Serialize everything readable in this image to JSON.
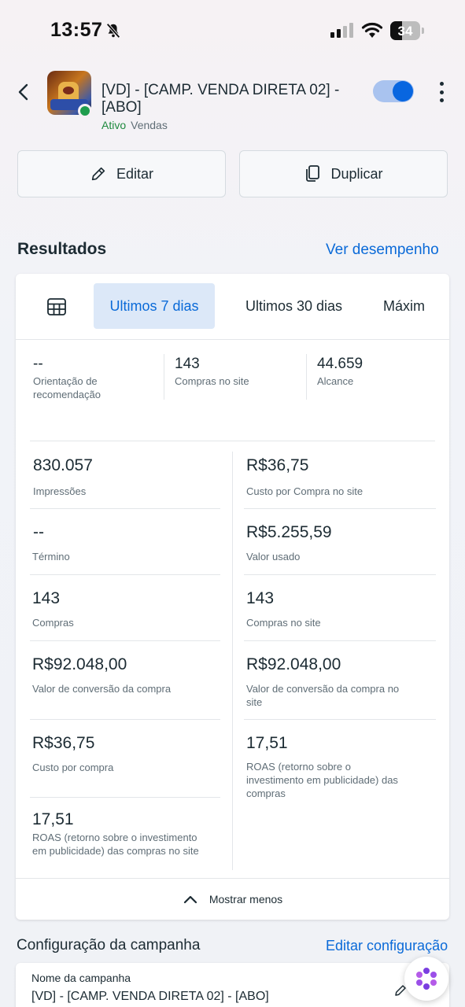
{
  "status_bar": {
    "time": "13:57",
    "battery": "34"
  },
  "header": {
    "campaign_title": "[VD] - [CAMP. VENDA DIRETA 02] - [ABO]",
    "status": "Ativo",
    "objective": "Vendas"
  },
  "actions": {
    "edit_label": "Editar",
    "duplicate_label": "Duplicar"
  },
  "results": {
    "title": "Resultados",
    "link": "Ver desempenho",
    "tabs": [
      "Ultimos 7 dias",
      "Ultimos 30 dias",
      "Máxim"
    ],
    "top_metrics": [
      {
        "value": "--",
        "label": "Orientação de recomendação"
      },
      {
        "value": "143",
        "label": "Compras no site"
      },
      {
        "value": "44.659",
        "label": "Alcance"
      }
    ],
    "left_metrics": [
      {
        "value": "830.057",
        "label": "Impressões"
      },
      {
        "value": "--",
        "label": "Término"
      },
      {
        "value": "143",
        "label": "Compras"
      },
      {
        "value": "R$92.048,00",
        "label": "Valor de conversão da compra"
      },
      {
        "value": "R$36,75",
        "label": "Custo por compra"
      },
      {
        "value": "17,51",
        "label": "ROAS (retorno sobre o investimento em publicidade) das compras no site"
      }
    ],
    "right_metrics": [
      {
        "value": "R$36,75",
        "label": "Custo por Compra no site"
      },
      {
        "value": "R$5.255,59",
        "label": "Valor usado"
      },
      {
        "value": "143",
        "label": "Compras no site"
      },
      {
        "value": "R$92.048,00",
        "label": "Valor de conversão da compra no site"
      },
      {
        "value": "17,51",
        "label": "ROAS (retorno sobre o investimento em publicidade) das compras"
      }
    ],
    "show_less": "Mostrar menos"
  },
  "config": {
    "title": "Configuração da campanha",
    "link": "Editar configuração",
    "name_label": "Nome da campanha",
    "name_value": "[VD] - [CAMP. VENDA DIRETA 02] - [ABO]"
  },
  "colors": {
    "accent": "#0a6ad8",
    "active_green": "#1f8a3f",
    "toggle_on": "#0866e0"
  },
  "icons": [
    "bell-off-icon",
    "signal-icon",
    "wifi-icon",
    "battery-icon",
    "back-arrow-icon",
    "kebab-menu-icon",
    "pencil-icon",
    "duplicate-icon",
    "table-icon",
    "chevron-up-icon",
    "ai-assistant-icon"
  ]
}
